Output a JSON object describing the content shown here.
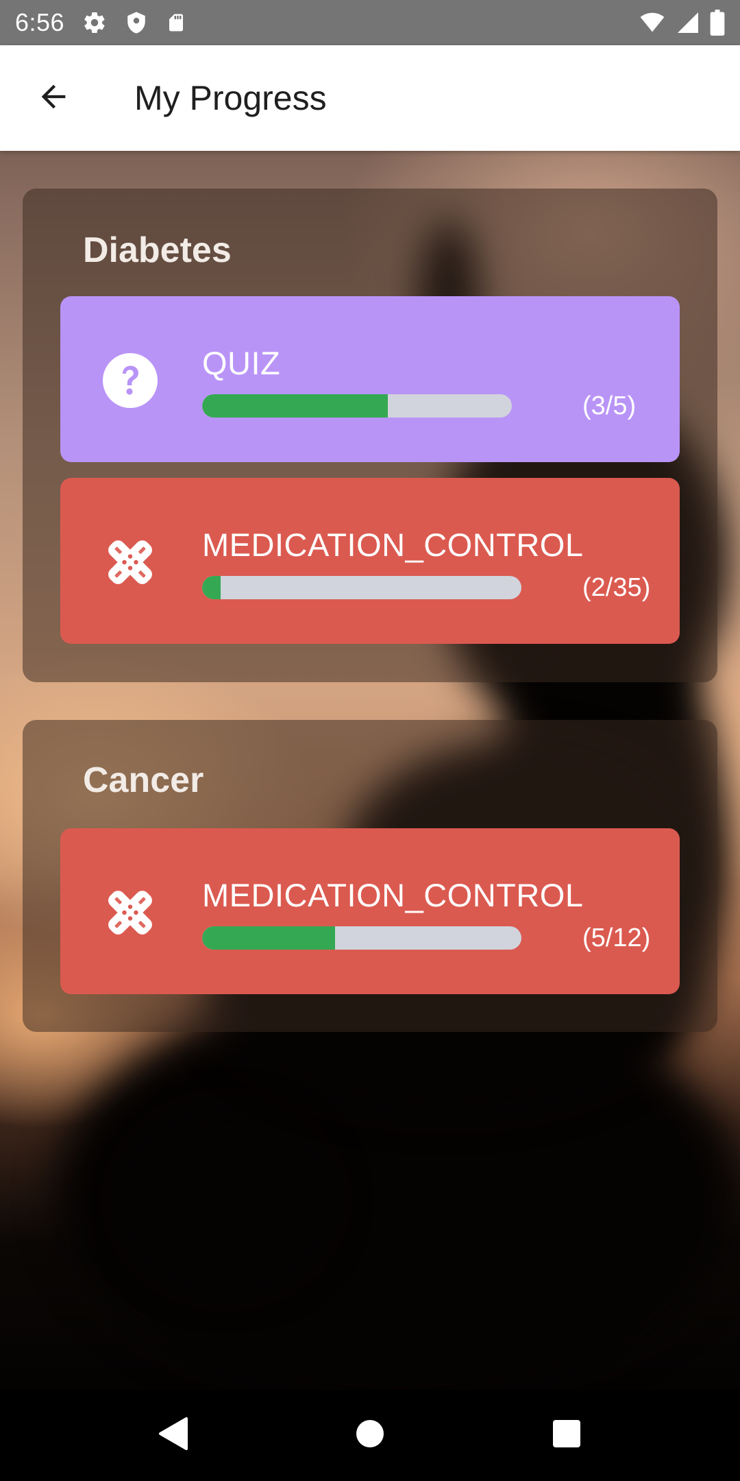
{
  "status_bar": {
    "time": "6:56",
    "icons": [
      "settings-icon",
      "shield-icon",
      "sd-card-icon",
      "wifi-icon",
      "signal-icon",
      "battery-icon"
    ]
  },
  "app_bar": {
    "title": "My Progress",
    "back_icon": "arrow-back-icon"
  },
  "colors": {
    "quiz_card": "#b994f7",
    "medication_card": "#db5a50",
    "progress_fill": "#35a853",
    "progress_track": "#d1d4dc"
  },
  "groups": [
    {
      "title": "Diabetes",
      "items": [
        {
          "type": "QUIZ",
          "icon": "question-circle-icon",
          "progress": 0.6,
          "count": "(3/5)"
        },
        {
          "type": "MEDICATION_CONTROL",
          "icon": "bandage-icon",
          "progress": 0.057,
          "count": "(2/35)"
        }
      ]
    },
    {
      "title": "Cancer",
      "items": [
        {
          "type": "MEDICATION_CONTROL",
          "icon": "bandage-icon",
          "progress": 0.417,
          "count": "(5/12)"
        }
      ]
    }
  ],
  "nav_bar": {
    "icons": [
      "back-triangle-icon",
      "home-circle-icon",
      "recents-square-icon"
    ]
  }
}
